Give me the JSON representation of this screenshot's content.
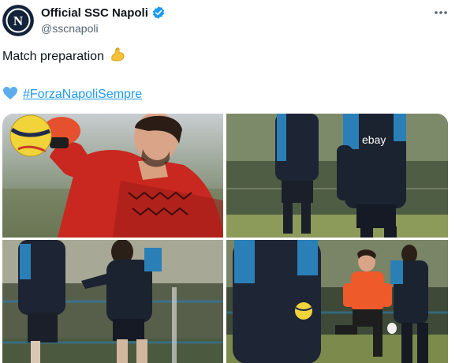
{
  "account": {
    "display_name": "Official SSC Napoli",
    "handle": "@sscnapoli",
    "avatar_letter": "N",
    "verified_icon": "verified-badge-icon",
    "more_icon": "more-horizontal-icon"
  },
  "tweet": {
    "text": "Match preparation",
    "emoji_icon": "flexed-biceps-icon",
    "heart_icon": "blue-heart-icon",
    "hashtag": "#ForzaNapoliSempre"
  },
  "media": {
    "photos": [
      {
        "name": "goalkeeper-catching-ball-photo"
      },
      {
        "name": "players-training-photo-2"
      },
      {
        "name": "players-running-photo-3"
      },
      {
        "name": "goalkeeper-drill-photo-4"
      }
    ],
    "jersey_sponsor": "ebay"
  },
  "colors": {
    "text": "#0f1419",
    "secondary": "#536471",
    "link": "#1d9bf0",
    "verified": "#1d9bf0",
    "napoli_navy": "#12233a"
  }
}
